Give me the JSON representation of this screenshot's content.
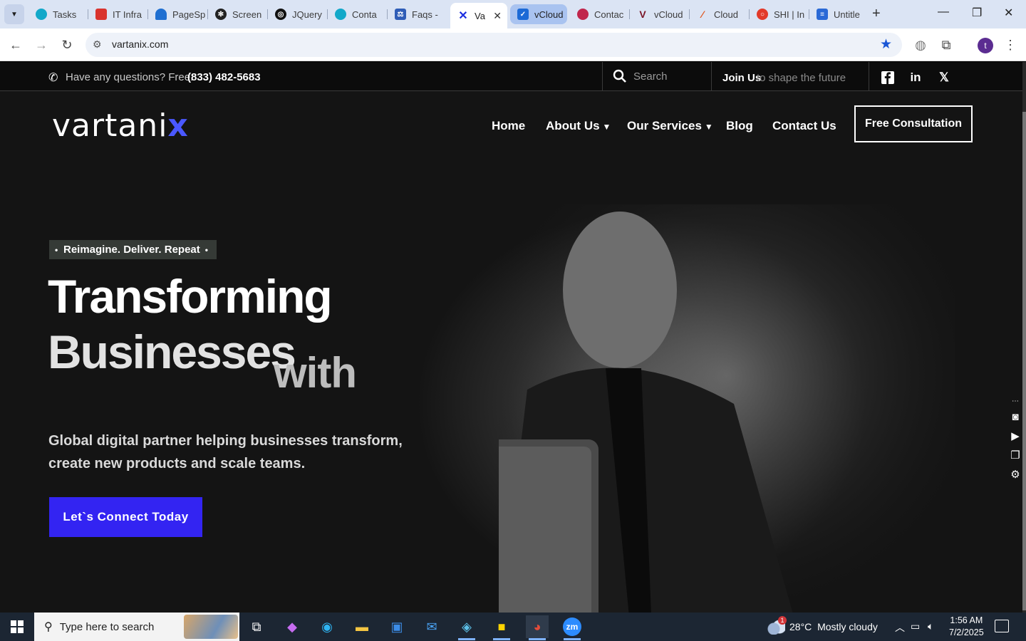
{
  "browser": {
    "tabs": [
      {
        "label": "Tasks",
        "icon": "globe-icon",
        "color": "#12a8c9"
      },
      {
        "label": "IT Infra",
        "icon": "jira-icon",
        "color": "#d9332e"
      },
      {
        "label": "PageSp",
        "icon": "pagespeed-icon",
        "color": "#1f6fd1"
      },
      {
        "label": "Screen",
        "icon": "gear-icon",
        "color": "#222222"
      },
      {
        "label": "JQuery",
        "icon": "chatgpt-icon",
        "color": "#111111"
      },
      {
        "label": "Conta",
        "icon": "globe-icon",
        "color": "#12a8c9"
      },
      {
        "label": "Faqs -",
        "icon": "scales-icon",
        "color": "#2f5db7"
      },
      {
        "label": "Va",
        "icon": "vartanix-icon",
        "color": "#1c2fe0",
        "active": true
      },
      {
        "label": "vCloud",
        "icon": "check-icon",
        "color": "#1c6ad6",
        "group": true
      },
      {
        "label": "Contac",
        "icon": "swirl-icon",
        "color": "#c0264c"
      },
      {
        "label": "vCloud",
        "icon": "v-icon",
        "color": "#7a1426"
      },
      {
        "label": "Cloud",
        "icon": "cloud-icon",
        "color": "#e0531a"
      },
      {
        "label": "SHI | In",
        "icon": "shi-icon",
        "color": "#e23a2a"
      },
      {
        "label": "Untitle",
        "icon": "doc-icon",
        "color": "#2a69d6"
      }
    ],
    "url": "vartanix.com",
    "profile_initial": "t"
  },
  "site": {
    "topbar": {
      "question": "Have any questions? Free:",
      "phone": "(833) 482-5683",
      "search_placeholder": "Search",
      "join_label": "Join Us",
      "join_sub": "to shape the future"
    },
    "logo": {
      "main": "vartani",
      "accent": "x"
    },
    "nav": {
      "home": "Home",
      "about": "About Us",
      "services": "Our Services",
      "blog": "Blog",
      "contact": "Contact Us"
    },
    "cta_label": "Free Consultation",
    "hero": {
      "tagline": "Reimagine. Deliver. Repeat",
      "line1": "Transforming",
      "line2": "Businesses",
      "line3": "with",
      "subtitle": "Global digital partner helping businesses transform, create new products and scale teams.",
      "button_label": "Let`s Connect Today"
    },
    "colors": {
      "accent": "#3324f2",
      "logo_accent": "#4a58ff",
      "background": "#111111"
    }
  },
  "taskbar": {
    "search_placeholder": "Type here to search",
    "weather_temp": "28°C",
    "weather_desc": "Mostly cloudy",
    "time": "1:56 AM",
    "date": "7/2/2025"
  }
}
